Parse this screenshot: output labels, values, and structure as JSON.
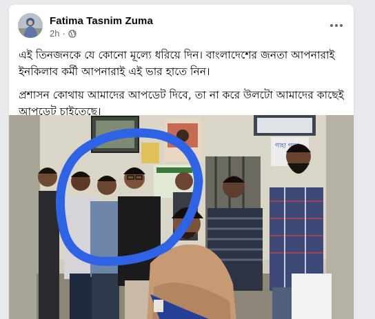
{
  "post": {
    "author": "Fatima Tasnim Zuma",
    "time": "2h",
    "separator": "·",
    "privacy_icon": "globe-icon",
    "more_icon": "more-options-icon",
    "paragraph_1": "এই তিনজনকে যে কোনো মূল্যে ধরিয়ে দিন। বাংলাদেশের জনতা আপনারাই ইনকিলাব কর্মী আপনারাই এই ভার হাতে নিন।",
    "paragraph_2": " প্রশাসন কোথায় আমাদের আপডেট দিবে, তা না করে উলটো আমাদের কাছেই আপডেট চাইতেছে।"
  },
  "photo": {
    "sign_1": "গাহা গাহা",
    "annotation_color": "#2f63e6"
  }
}
